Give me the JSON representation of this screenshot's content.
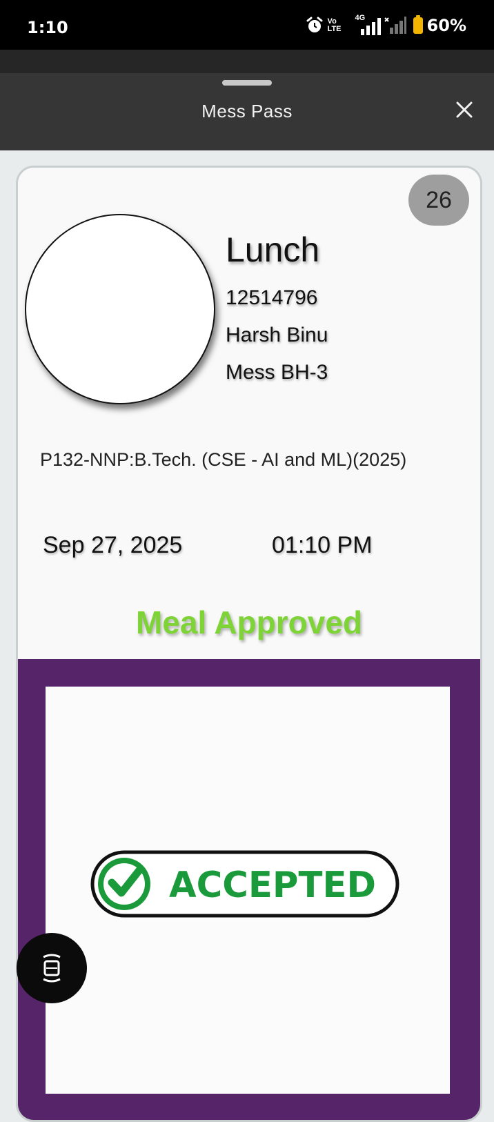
{
  "status_bar": {
    "time": "1:10",
    "network_label_top": "Vo",
    "network_label_bottom": "LTE",
    "network_type": "4G",
    "battery_percent": "60%"
  },
  "sheet": {
    "title": "Mess Pass"
  },
  "pass": {
    "counter": "26",
    "meal": "Lunch",
    "id": "12514796",
    "name": "Harsh Binu",
    "mess": "Mess BH-3",
    "program": "P132-NNP:B.Tech. (CSE - AI and ML)(2025)",
    "date": "Sep 27, 2025",
    "time": "01:10 PM",
    "status": "Meal Approved",
    "stamp_text": "ACCEPTED"
  },
  "colors": {
    "approved_green": "#7ed336",
    "purple": "#562468",
    "stamp_green": "#1a9a3a"
  },
  "icons": [
    "alarm-icon",
    "signal-icon",
    "battery-icon",
    "close-icon",
    "check-circle-icon",
    "scan-icon"
  ]
}
